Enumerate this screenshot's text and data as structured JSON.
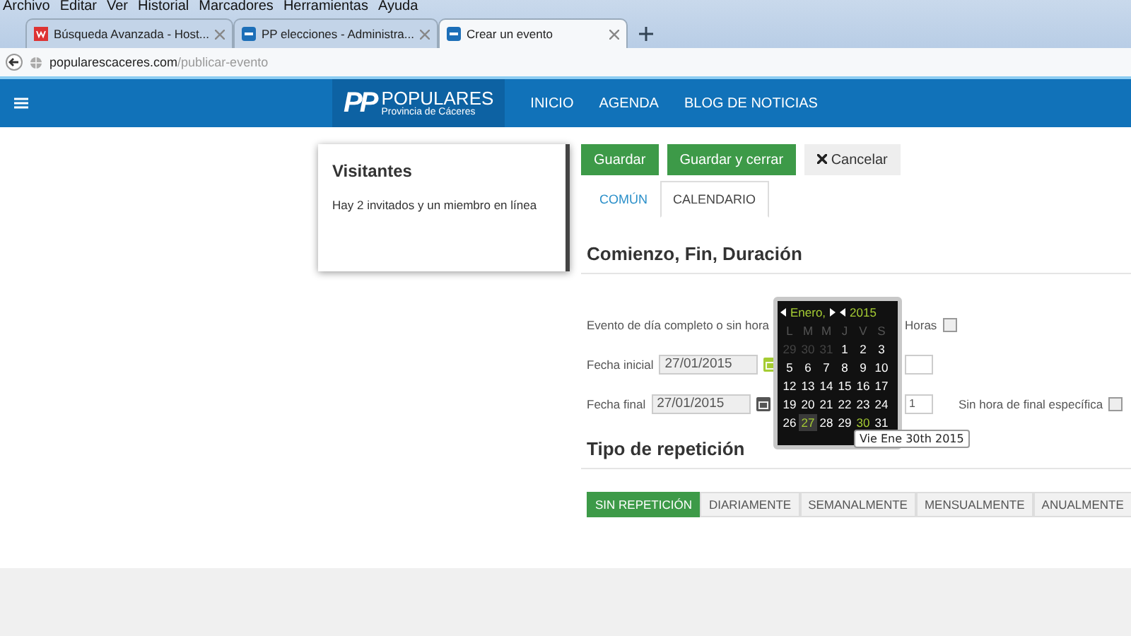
{
  "menu": [
    "Archivo",
    "Editar",
    "Ver",
    "Historial",
    "Marcadores",
    "Herramientas",
    "Ayuda"
  ],
  "browser_tabs": [
    {
      "title": "Búsqueda Avanzada - Host...",
      "selected": false,
      "kind": "red"
    },
    {
      "title": "PP elecciones - Administra...",
      "selected": false,
      "kind": "blue"
    },
    {
      "title": "Crear un evento",
      "selected": true,
      "kind": "blue"
    }
  ],
  "address": {
    "domain": "popularescaceres.com",
    "path": "/publicar-evento"
  },
  "site": {
    "logo": "PP",
    "name": "POPULARES",
    "subtitle": "Provincia de Cáceres"
  },
  "nav": [
    "INICIO",
    "AGENDA",
    "BLOG DE NOTICIAS"
  ],
  "sidebar": {
    "title": "Visitantes",
    "text": "Hay 2 invitados y un miembro en línea"
  },
  "actions": [
    {
      "label": "Guardar",
      "kind": "primary"
    },
    {
      "label": "Guardar y cerrar",
      "kind": "primary"
    },
    {
      "label": "Cancelar",
      "kind": "cancel"
    }
  ],
  "form_tabs": [
    {
      "label": "COMÚN",
      "selected": false
    },
    {
      "label": "CALENDARIO",
      "selected": true
    }
  ],
  "section_1": "Comienzo, Fin, Duración",
  "all_day": {
    "label": "Evento de día completo o sin hora",
    "label_tail": "Horas",
    "checked": false
  },
  "start": {
    "label": "Fecha inicial",
    "value": "27/01/2015",
    "picker_open": true
  },
  "end": {
    "label": "Fecha final",
    "value": "27/01/2015",
    "picker_open": false,
    "time_value": "1"
  },
  "no_end_time": {
    "label": "Sin hora de final específica",
    "checked": false
  },
  "datepicker": {
    "month": "Enero,",
    "year": "2015",
    "weekdays": [
      "L",
      "M",
      "M",
      "J",
      "V",
      "S"
    ],
    "weeks": [
      [
        {
          "day": "29",
          "muted": true,
          "selected": false,
          "highlight": false
        },
        {
          "day": "30",
          "muted": true,
          "selected": false,
          "highlight": false
        },
        {
          "day": "31",
          "muted": true,
          "selected": false,
          "highlight": false
        },
        {
          "day": "1",
          "muted": false,
          "selected": false,
          "highlight": false
        },
        {
          "day": "2",
          "muted": false,
          "selected": false,
          "highlight": false
        },
        {
          "day": "3",
          "muted": false,
          "selected": false,
          "highlight": false
        }
      ],
      [
        {
          "day": "5",
          "muted": false,
          "selected": false,
          "highlight": false
        },
        {
          "day": "6",
          "muted": false,
          "selected": false,
          "highlight": false
        },
        {
          "day": "7",
          "muted": false,
          "selected": false,
          "highlight": false
        },
        {
          "day": "8",
          "muted": false,
          "selected": false,
          "highlight": false
        },
        {
          "day": "9",
          "muted": false,
          "selected": false,
          "highlight": false
        },
        {
          "day": "10",
          "muted": false,
          "selected": false,
          "highlight": false
        }
      ],
      [
        {
          "day": "12",
          "muted": false,
          "selected": false,
          "highlight": false
        },
        {
          "day": "13",
          "muted": false,
          "selected": false,
          "highlight": false
        },
        {
          "day": "14",
          "muted": false,
          "selected": false,
          "highlight": false
        },
        {
          "day": "15",
          "muted": false,
          "selected": false,
          "highlight": false
        },
        {
          "day": "16",
          "muted": false,
          "selected": false,
          "highlight": false
        },
        {
          "day": "17",
          "muted": false,
          "selected": false,
          "highlight": false
        }
      ],
      [
        {
          "day": "19",
          "muted": false,
          "selected": false,
          "highlight": false
        },
        {
          "day": "20",
          "muted": false,
          "selected": false,
          "highlight": false
        },
        {
          "day": "21",
          "muted": false,
          "selected": false,
          "highlight": false
        },
        {
          "day": "22",
          "muted": false,
          "selected": false,
          "highlight": false
        },
        {
          "day": "23",
          "muted": false,
          "selected": false,
          "highlight": false
        },
        {
          "day": "24",
          "muted": false,
          "selected": false,
          "highlight": false
        }
      ],
      [
        {
          "day": "26",
          "muted": false,
          "selected": false,
          "highlight": false
        },
        {
          "day": "27",
          "muted": false,
          "selected": true,
          "highlight": false
        },
        {
          "day": "28",
          "muted": false,
          "selected": false,
          "highlight": false
        },
        {
          "day": "29",
          "muted": false,
          "selected": false,
          "highlight": false
        },
        {
          "day": "30",
          "muted": false,
          "selected": false,
          "highlight": true
        },
        {
          "day": "31",
          "muted": false,
          "selected": false,
          "highlight": false
        }
      ]
    ]
  },
  "tooltip": "Vie Ene 30th 2015",
  "section_2": "Tipo de repetición",
  "repeat": [
    {
      "label": "SIN REPETICIÓN",
      "selected": true
    },
    {
      "label": "DIARIAMENTE",
      "selected": false
    },
    {
      "label": "SEMANALMENTE",
      "selected": false
    },
    {
      "label": "MENSUALMENTE",
      "selected": false
    },
    {
      "label": "ANUALMENTE",
      "selected": false
    }
  ]
}
